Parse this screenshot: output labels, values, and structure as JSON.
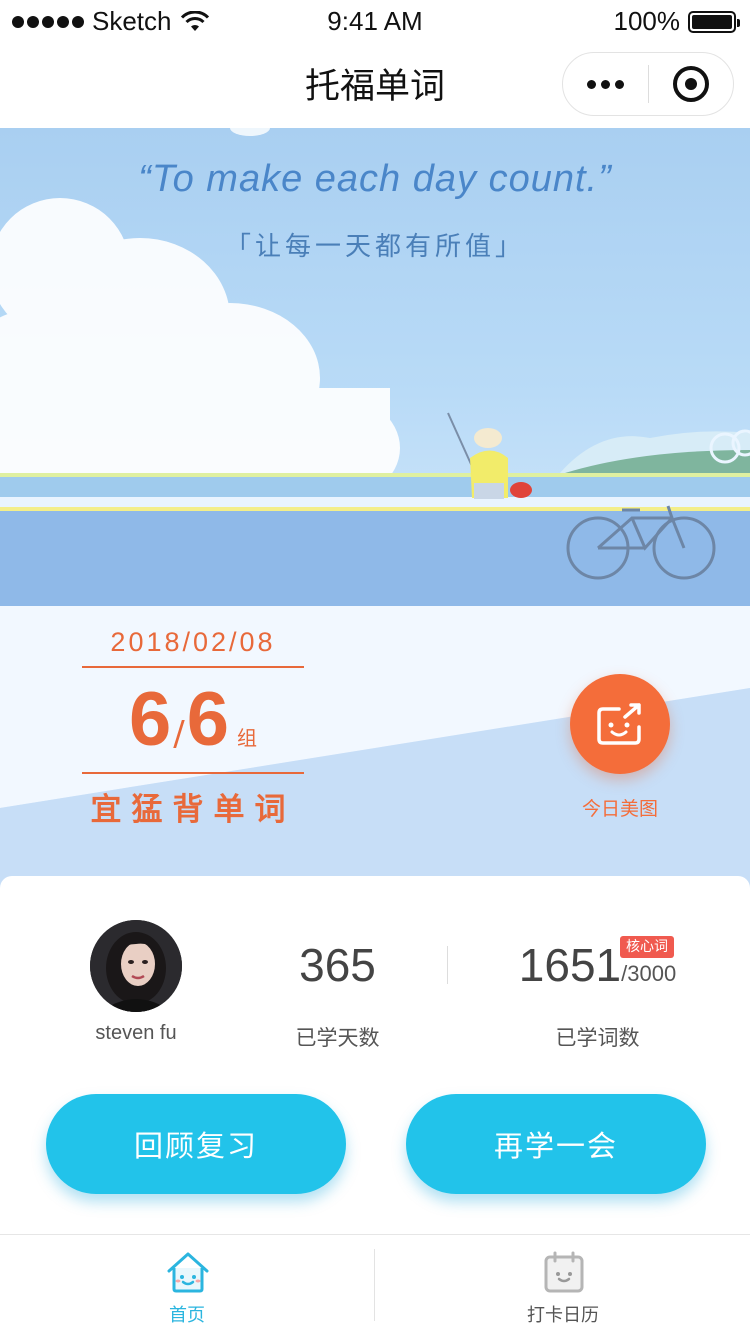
{
  "status_bar": {
    "carrier": "Sketch",
    "time": "9:41 AM",
    "battery": "100%"
  },
  "nav": {
    "title": "托福单词"
  },
  "hero": {
    "quote_en": "“To make each day count.”",
    "quote_zh": "「让每一天都有所值」",
    "date": "2018/02/08",
    "progress_done": "6",
    "progress_sep": "/",
    "progress_total": "6",
    "progress_unit": "组",
    "motto": "宜猛背单词",
    "photo_label": "今日美图"
  },
  "profile": {
    "username": "steven fu"
  },
  "stats": {
    "days_value": "365",
    "days_label": "已学天数",
    "words_value": "1651",
    "words_total": "/3000",
    "words_badge": "核心词",
    "words_label": "已学词数"
  },
  "actions": {
    "review_label": "回顾复习",
    "learn_label": "再学一会"
  },
  "tabs": [
    {
      "label": "首页",
      "icon": "home-icon",
      "active": true
    },
    {
      "label": "打卡日历",
      "icon": "calendar-icon",
      "active": false
    }
  ],
  "colors": {
    "accent": "#22c3ea",
    "orange": "#f46d3a",
    "badge": "#f05a4f",
    "tab_active": "#2bb5df"
  }
}
